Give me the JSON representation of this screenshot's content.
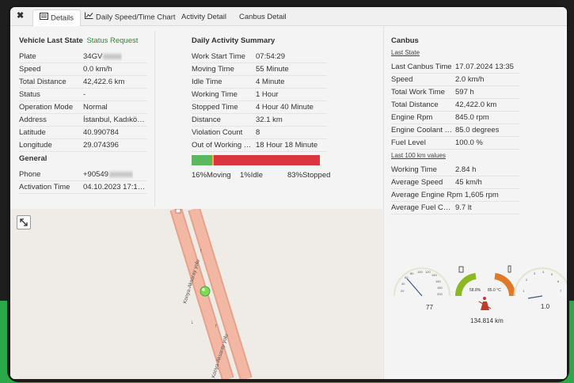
{
  "tabs": {
    "close": "✖",
    "details": "Details",
    "speed_chart": "Daily Speed/Time Chart",
    "activity_detail": "Activity Detail",
    "canbus_detail": "Canbus Detail"
  },
  "vehicle": {
    "title": "Vehicle Last State",
    "status_request": "Status Request",
    "rows": [
      {
        "k": "Plate",
        "v": "34GV"
      },
      {
        "k": "Speed",
        "v": "0.0 km/h"
      },
      {
        "k": "Total Distance",
        "v": "42,422.6 km"
      },
      {
        "k": "Status",
        "v": "-"
      },
      {
        "k": "Operation Mode",
        "v": "Normal"
      },
      {
        "k": "Address",
        "v": "İstanbul, Kadıköy, ..."
      },
      {
        "k": "Latitude",
        "v": "40.990784"
      },
      {
        "k": "Longitude",
        "v": "29.074396"
      }
    ]
  },
  "general": {
    "title": "General",
    "rows": [
      {
        "k": "Phone",
        "v": "+90549"
      },
      {
        "k": "Activation Time",
        "v": "04.10.2023 17:15:..."
      }
    ]
  },
  "activity": {
    "title": "Daily Activity Summary",
    "rows": [
      {
        "k": "Work Start Time",
        "v": "07:54:29"
      },
      {
        "k": "Moving Time",
        "v": "55 Minute"
      },
      {
        "k": "Idle Time",
        "v": "4 Minute"
      },
      {
        "k": "Working Time",
        "v": "1 Hour"
      },
      {
        "k": "Stopped Time",
        "v": "4 Hour 40 Minute"
      },
      {
        "k": "Distance",
        "v": "32.1 km"
      },
      {
        "k": "Violation Count",
        "v": "8"
      },
      {
        "k": "Out of Working Ho...",
        "v": "18 Hour 18 Minute"
      }
    ],
    "bar": {
      "moving": 16,
      "idle": 1,
      "stopped": 83,
      "moving_color": "#5cb85c",
      "idle_color": "#f0ad4e",
      "stopped_color": "#d9363e"
    },
    "legend": {
      "moving": "16%Moving",
      "idle": "1%Idle",
      "stopped": "83%Stopped"
    }
  },
  "canbus": {
    "title": "Canbus",
    "last_state": "Last State",
    "rows": [
      {
        "k": "Last Canbus Time",
        "v": "17.07.2024 13:35"
      },
      {
        "k": "Speed",
        "v": "2.0 km/h"
      },
      {
        "k": "Total Work Time",
        "v": "597 h"
      },
      {
        "k": "Total Distance",
        "v": "42,422.0 km"
      },
      {
        "k": "Engine Rpm",
        "v": "845.0 rpm"
      },
      {
        "k": "Engine Coolant Te...",
        "v": "85.0 degrees"
      },
      {
        "k": "Fuel Level",
        "v": "100.0 %"
      }
    ],
    "last_100": "Last 100 km values",
    "rows100": [
      {
        "k": "Working Time",
        "v": "2.84 h"
      },
      {
        "k": "Average Speed",
        "v": "45 km/h"
      },
      {
        "k": "Average Engine Rpm",
        "v": "1,605 rpm"
      },
      {
        "k": "Average Fuel Cons...",
        "v": "9.7 lt"
      }
    ]
  },
  "gauges": {
    "speed_value": "77",
    "speed_ticks": [
      "20",
      "40",
      "60",
      "80",
      "100",
      "120",
      "140",
      "160",
      "180",
      "200"
    ],
    "fuel_label": "58.8%",
    "temp_label": "85.0 °C",
    "rpm_value": "1.0",
    "rpm_ticks": [
      "1",
      "2",
      "3",
      "4",
      "5",
      "6",
      "7"
    ],
    "odometer": "134.814 km"
  },
  "map": {
    "road_label_1": "Konya-Aksaray yolu",
    "road_label_2": "Konya-Aksaray yolu"
  }
}
